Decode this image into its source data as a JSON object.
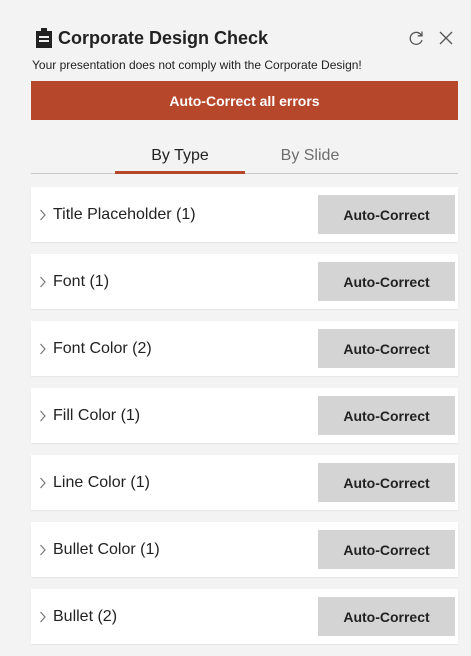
{
  "header": {
    "title": "Corporate Design Check",
    "subtitle": "Your presentation does not comply with the Corporate Design!",
    "icons": [
      "document-icon",
      "refresh-icon",
      "close-icon"
    ]
  },
  "actions": {
    "autocorrect_all_label": "Auto-Correct all errors"
  },
  "tabs": [
    {
      "label": "By Type",
      "active": true
    },
    {
      "label": "By Slide",
      "active": false
    }
  ],
  "errors": [
    {
      "label": "Title Placeholder (1)",
      "button": "Auto-Correct"
    },
    {
      "label": "Font (1)",
      "button": "Auto-Correct"
    },
    {
      "label": "Font Color (2)",
      "button": "Auto-Correct"
    },
    {
      "label": "Fill Color (1)",
      "button": "Auto-Correct"
    },
    {
      "label": "Line Color (1)",
      "button": "Auto-Correct"
    },
    {
      "label": "Bullet Color (1)",
      "button": "Auto-Correct"
    },
    {
      "label": "Bullet (2)",
      "button": "Auto-Correct"
    }
  ],
  "colors": {
    "accent": "#b7472a",
    "panel_background": "#f3f3f3",
    "row_background": "#ffffff",
    "button_background": "#d4d4d4"
  }
}
